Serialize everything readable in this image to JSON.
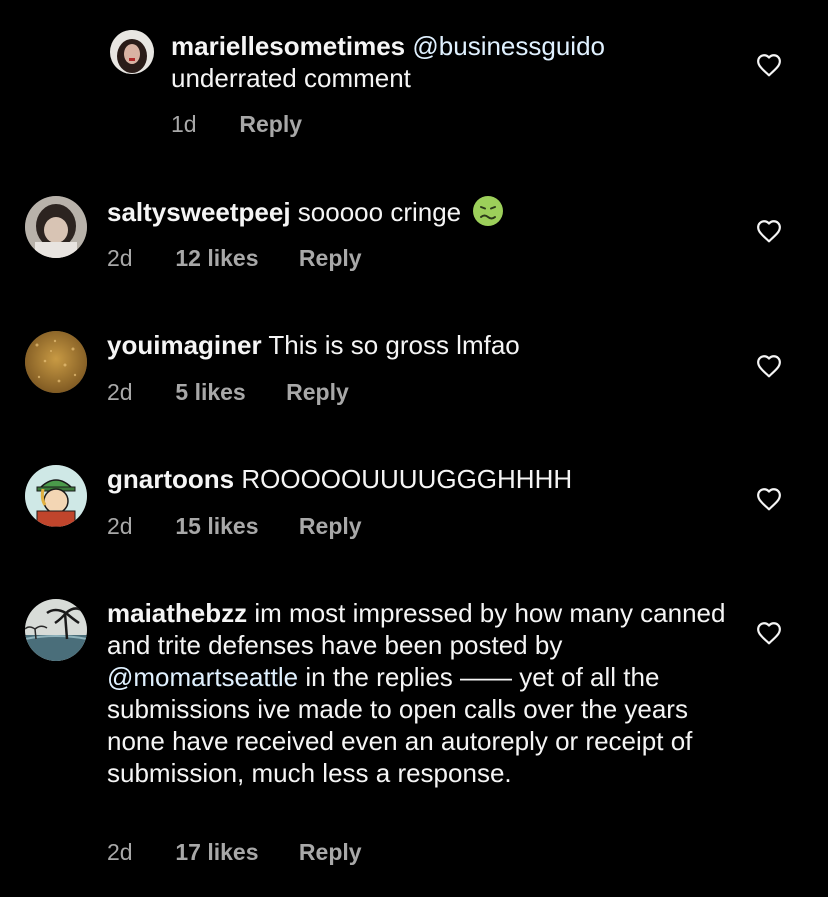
{
  "comments": [
    {
      "username": "mariellesometimes",
      "mention": "@businessguido",
      "text": "underrated comment",
      "time": "1d",
      "likes": "",
      "reply": "Reply"
    },
    {
      "username": "saltysweetpeej",
      "text": "sooooo cringe",
      "emoji": "nauseated-face",
      "time": "2d",
      "likes": "12 likes",
      "reply": "Reply"
    },
    {
      "username": "youimaginer",
      "text": "This is so gross lmfao",
      "time": "2d",
      "likes": "5 likes",
      "reply": "Reply"
    },
    {
      "username": "gnartoons",
      "text": "ROOOOOUUUUGGGHHHH",
      "time": "2d",
      "likes": "15 likes",
      "reply": "Reply"
    },
    {
      "username": "maiathebzz",
      "text_a": "im most impressed by how many canned and trite defenses have been posted by",
      "mention": "@momartseattle",
      "text_b": "in the replies —— yet of all the submissions ive made to open calls over the years none have received even an autoreply or receipt of submission, much less a response.",
      "time": "2d",
      "likes": "17 likes",
      "reply": "Reply"
    }
  ],
  "colors": {
    "background": "#000000",
    "text": "#f5f5f5",
    "meta": "#a8a8a8",
    "mention": "#e0f1ff"
  },
  "icons": {
    "like": "heart-outline-icon",
    "emoji": "nauseated-face"
  }
}
